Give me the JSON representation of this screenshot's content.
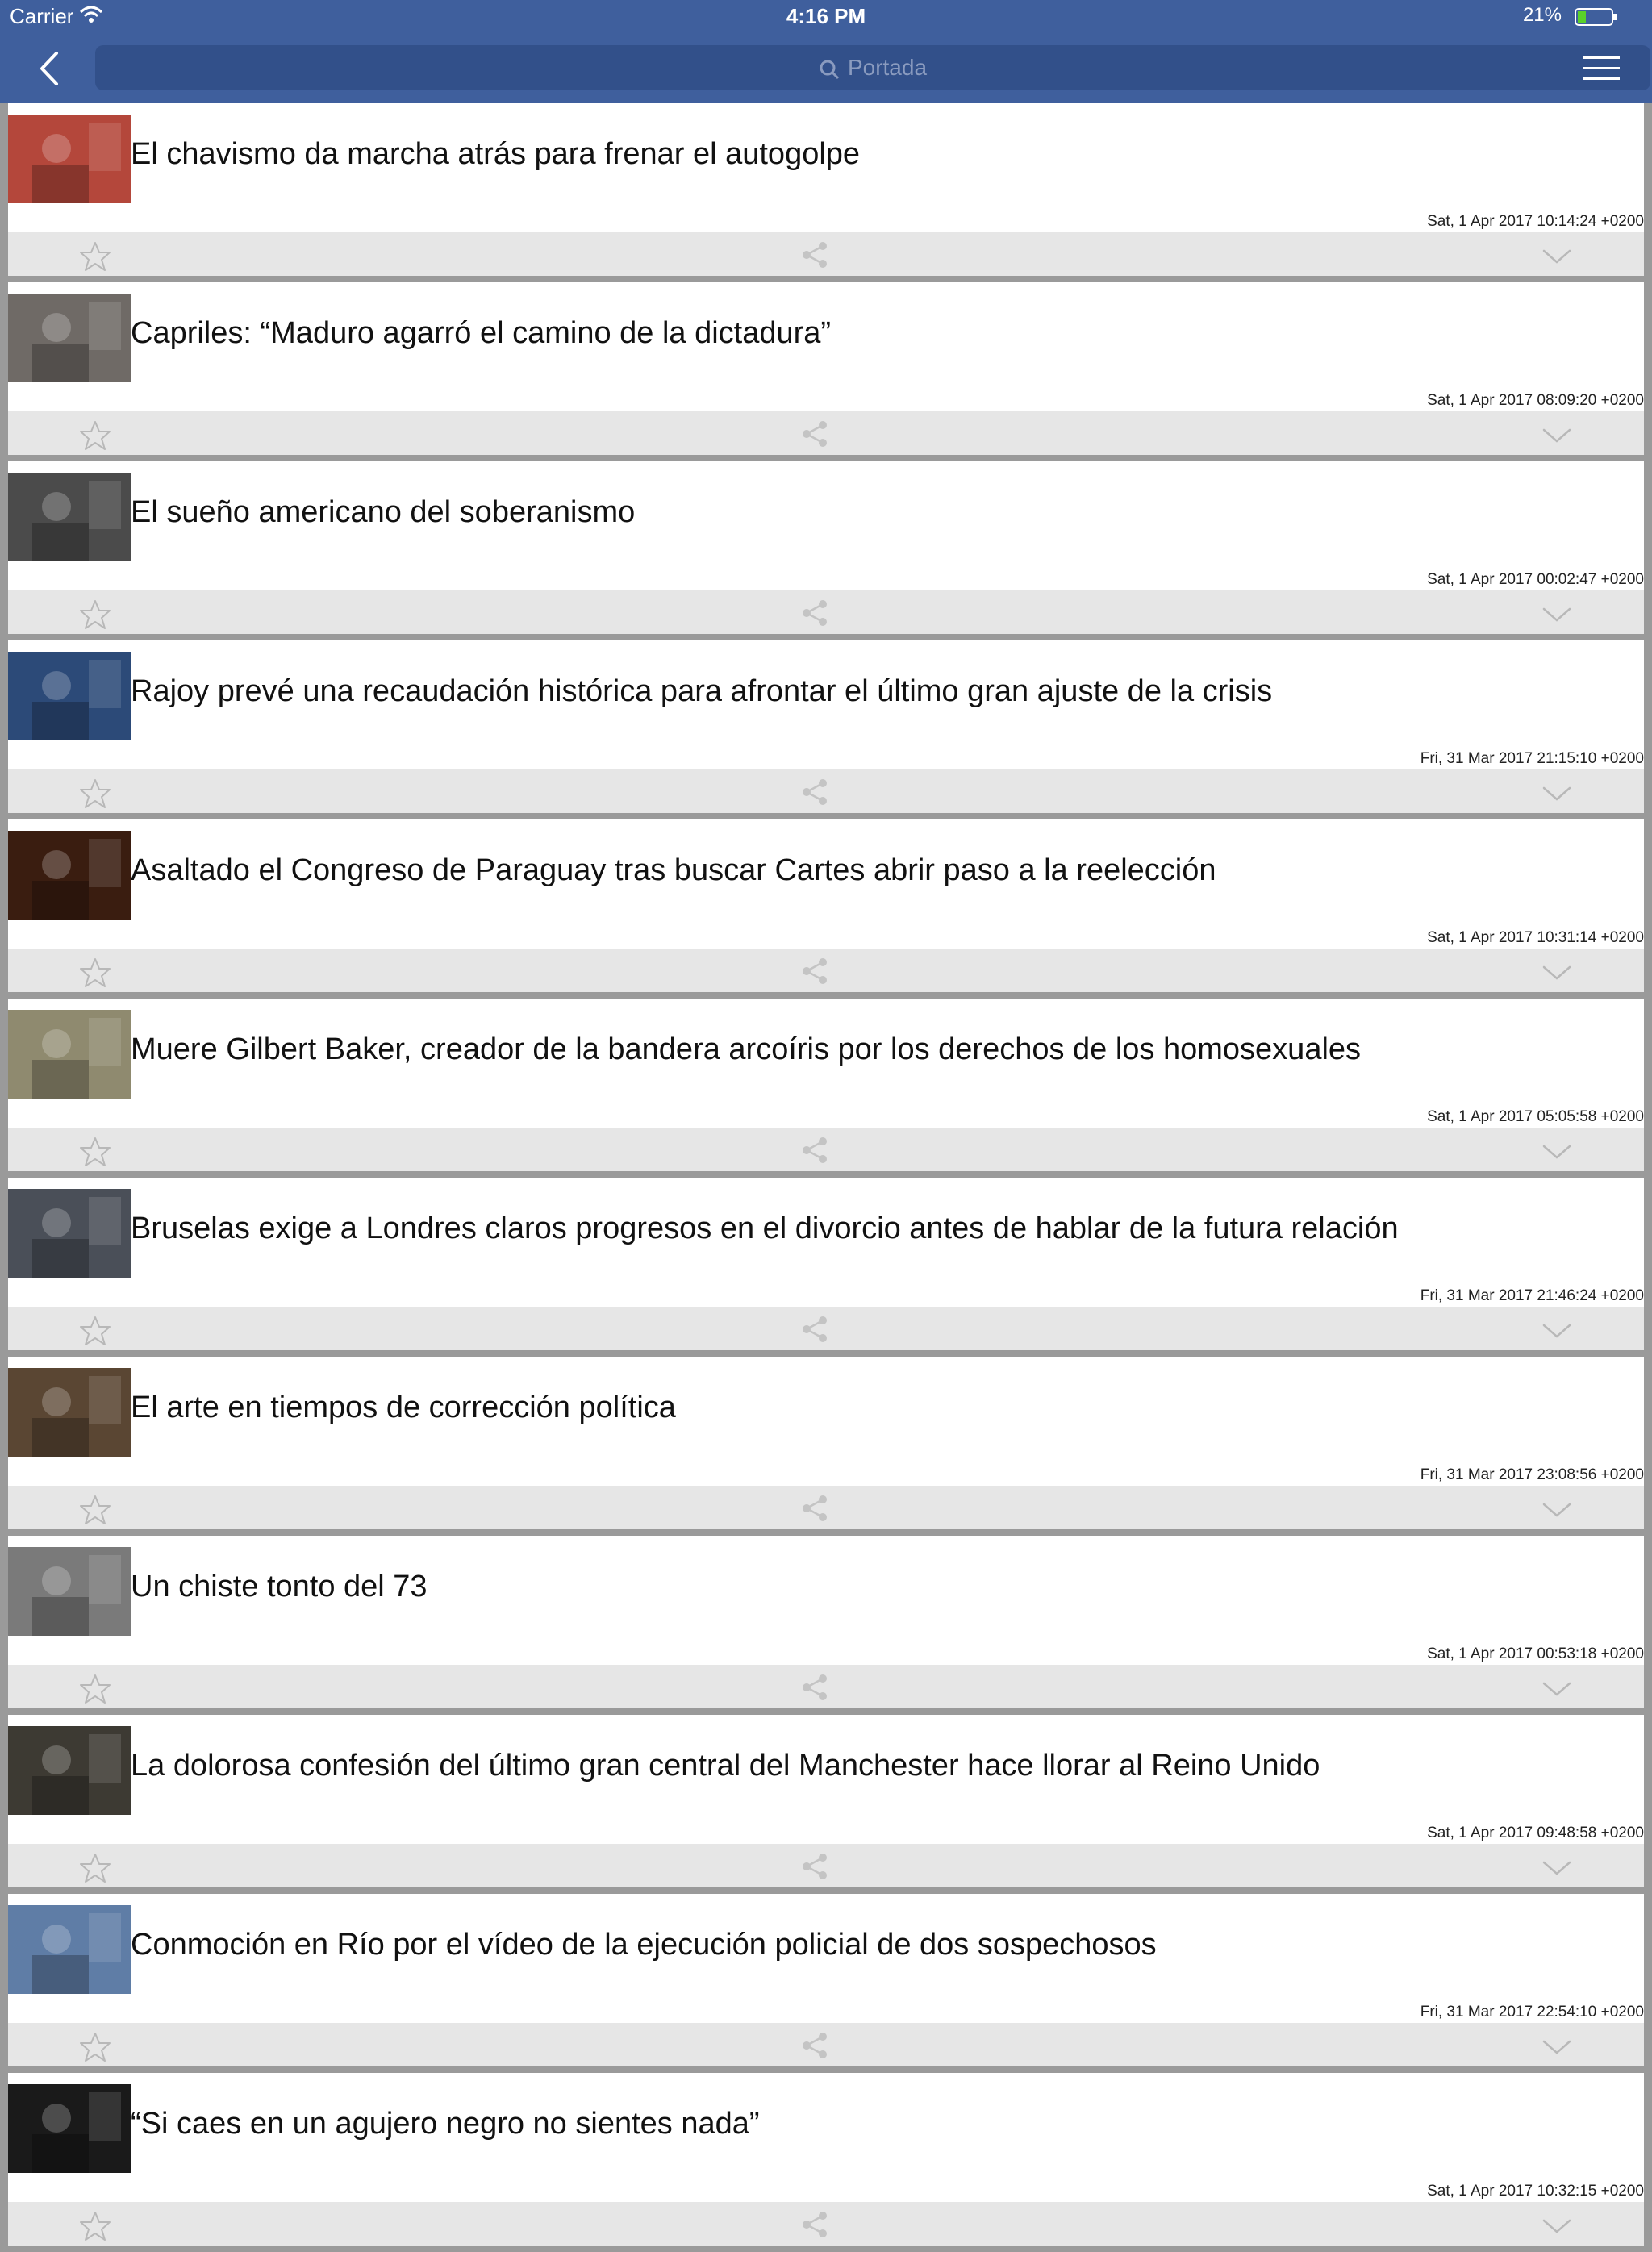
{
  "status": {
    "carrier": "Carrier",
    "time": "4:16 PM",
    "battery": "21%"
  },
  "search": {
    "placeholder": "Portada"
  },
  "articles": [
    {
      "title": "El chavismo da marcha atrás para frenar el autogolpe",
      "date": "Sat, 1 Apr 2017 10:14:24 +0200",
      "thumb_color": "#b4473b"
    },
    {
      "title": "Capriles: “Maduro agarró el camino de la dictadura”",
      "date": "Sat, 1 Apr 2017 08:09:20 +0200",
      "thumb_color": "#6f6a66"
    },
    {
      "title": "El sueño americano del soberanismo",
      "date": "Sat, 1 Apr 2017 00:02:47 +0200",
      "thumb_color": "#4b4b4b"
    },
    {
      "title": "Rajoy prevé una recaudación histórica para afrontar el último gran ajuste de la crisis",
      "date": "Fri, 31 Mar 2017 21:15:10 +0200",
      "thumb_color": "#2c4a78"
    },
    {
      "title": "Asaltado el Congreso de Paraguay tras buscar Cartes abrir paso a la reelección",
      "date": "Sat, 1 Apr 2017 10:31:14 +0200",
      "thumb_color": "#3a1d10"
    },
    {
      "title": "Muere Gilbert Baker, creador de la bandera arcoíris por los derechos de los homosexuales",
      "date": "Sat, 1 Apr 2017 05:05:58 +0200",
      "thumb_color": "#8f8a6f"
    },
    {
      "title": "Bruselas exige a Londres claros progresos en el divorcio antes de hablar de la futura relación",
      "date": "Fri, 31 Mar 2017 21:46:24 +0200",
      "thumb_color": "#4a4f58"
    },
    {
      "title": "El arte en tiempos de corrección política",
      "date": "Fri, 31 Mar 2017 23:08:56 +0200",
      "thumb_color": "#5a4633"
    },
    {
      "title": "Un chiste tonto del 73",
      "date": "Sat, 1 Apr 2017 00:53:18 +0200",
      "thumb_color": "#7a7a7a"
    },
    {
      "title": "La dolorosa confesión del último gran central del Manchester hace llorar al Reino Unido",
      "date": "Sat, 1 Apr 2017 09:48:58 +0200",
      "thumb_color": "#3d3a33"
    },
    {
      "title": "Conmoción en Río por el vídeo de la ejecución policial de dos sospechosos",
      "date": "Fri, 31 Mar 2017 22:54:10 +0200",
      "thumb_color": "#5f7da6"
    },
    {
      "title": "“Si caes en un agujero negro no sientes nada”",
      "date": "Sat, 1 Apr 2017 10:32:15 +0200",
      "thumb_color": "#1a1a1a"
    }
  ],
  "icons": {
    "back": "chevron-left-icon",
    "search": "search-icon",
    "menu": "hamburger-menu-icon",
    "favorite": "star-icon",
    "share": "share-icon",
    "expand": "chevron-down-icon"
  }
}
